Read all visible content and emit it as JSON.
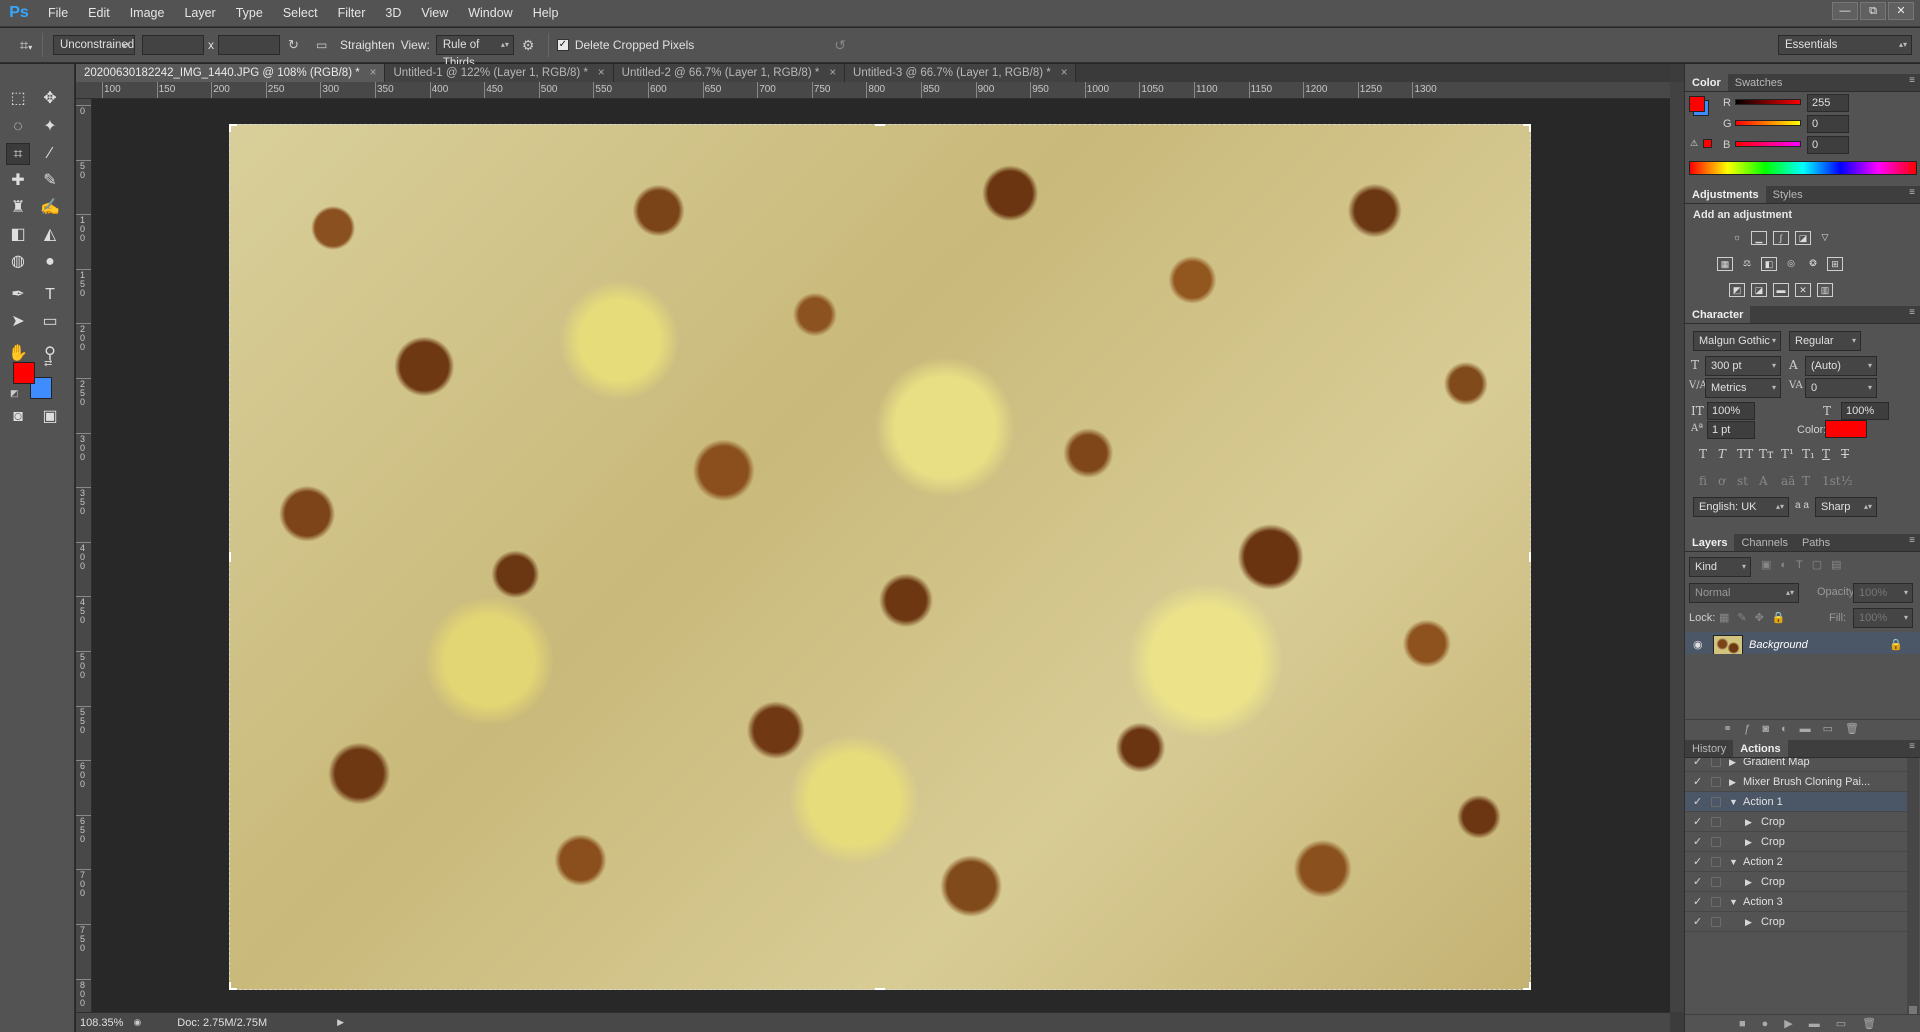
{
  "app": {
    "logo": "Ps"
  },
  "menu": [
    "File",
    "Edit",
    "Image",
    "Layer",
    "Type",
    "Select",
    "Filter",
    "3D",
    "View",
    "Window",
    "Help"
  ],
  "window_controls": [
    "—",
    "⧉",
    "✕"
  ],
  "options": {
    "ratio": "Unconstrained",
    "x_sep": "x",
    "straighten": "Straighten",
    "view_label": "View:",
    "view_value": "Rule of Thirds",
    "delete_cropped": "Delete Cropped Pixels",
    "delete_cropped_checked": true,
    "workspace": "Essentials"
  },
  "tabs": [
    {
      "label": "20200630182242_IMG_1440.JPG @ 108% (RGB/8) *",
      "active": true
    },
    {
      "label": "Untitled-1 @ 122% (Layer 1, RGB/8) *",
      "active": false
    },
    {
      "label": "Untitled-2 @ 66.7% (Layer 1, RGB/8) *",
      "active": false
    },
    {
      "label": "Untitled-3 @ 66.7% (Layer 1, RGB/8) *",
      "active": false
    }
  ],
  "hruler": [
    "100",
    "150",
    "200",
    "250",
    "300",
    "350",
    "400",
    "450",
    "500",
    "550",
    "600",
    "650",
    "700",
    "750",
    "800",
    "850",
    "900",
    "950",
    "1000",
    "1050",
    "1100",
    "1150",
    "1200",
    "1250",
    "1300"
  ],
  "vruler": [
    "0",
    "5 0",
    "1 0 0",
    "1 5 0",
    "2 0 0",
    "2 5 0",
    "3 0 0",
    "3 5 0",
    "4 0 0",
    "4 5 0",
    "5 0 0",
    "5 5 0",
    "6 0 0",
    "6 5 0",
    "7 0 0",
    "7 5 0",
    "8 0 0"
  ],
  "status": {
    "zoom": "108.35%",
    "doc": "Doc: 2.75M/2.75M"
  },
  "color_panel": {
    "tabs": [
      "Color",
      "Swatches"
    ],
    "r_label": "R",
    "g_label": "G",
    "b_label": "B",
    "r": "255",
    "g": "0",
    "b": "0",
    "foreground": "#ff0000",
    "background": "#3f8cff"
  },
  "adjustments": {
    "tabs": [
      "Adjustments",
      "Styles"
    ],
    "title": "Add an adjustment"
  },
  "character": {
    "title": "Character",
    "font": "Malgun Gothic",
    "style": "Regular",
    "size": "300 pt",
    "leading": "(Auto)",
    "kerning": "Metrics",
    "tracking": "0",
    "vscale": "100%",
    "hscale": "100%",
    "baseline": "1 pt",
    "color_label": "Color:",
    "text_color": "#ff0000",
    "language": "English: UK",
    "aa_label": "a a",
    "antialias": "Sharp"
  },
  "layers": {
    "tabs": [
      "Layers",
      "Channels",
      "Paths"
    ],
    "kind": "Kind",
    "blend": "Normal",
    "opacity_label": "Opacity:",
    "opacity": "100%",
    "lock_label": "Lock:",
    "fill_label": "Fill:",
    "fill": "100%",
    "layer_name": "Background"
  },
  "actions": {
    "tabs": [
      "History",
      "Actions"
    ],
    "rows": [
      {
        "label": "Gradient Map",
        "indent": 1
      },
      {
        "label": "Mixer Brush Cloning Pai...",
        "indent": 1
      },
      {
        "label": "Action 1",
        "indent": 1,
        "selected": true
      },
      {
        "label": "Crop",
        "indent": 2
      },
      {
        "label": "Crop",
        "indent": 2
      },
      {
        "label": "Action 2",
        "indent": 1
      },
      {
        "label": "Crop",
        "indent": 2
      },
      {
        "label": "Action 3",
        "indent": 1
      },
      {
        "label": "Crop",
        "indent": 2
      }
    ]
  }
}
